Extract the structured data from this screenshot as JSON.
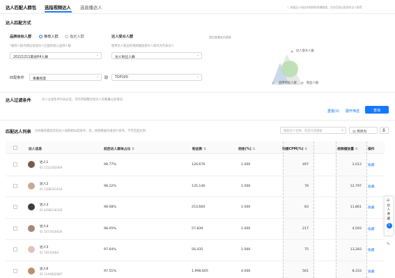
{
  "tabs": [
    {
      "label": "达人匹配人群包",
      "active": false
    },
    {
      "label": "选指视频达人",
      "active": true
    },
    {
      "label": "选直播达人",
      "active": false
    }
  ],
  "notice": "ⓘ 根据达人粉丝的视频和直播数据，优先匹配出契合的达人推荐",
  "section1": {
    "title": "达人匹配方式",
    "brand_label": "品牌目标人群",
    "radio_recommend": "推荐人群",
    "radio_custom": "指定人群",
    "brand_hint": "*推荐人群为建议投放达人匹配的核心品牌人群",
    "brand_select": "20221211美妆R4人群",
    "influencer_label": "达人受众人群",
    "influencer_hint": "使用达人粉丝的视频播放受众人群作为代表达人",
    "influencer_select": "达人粉丝人群",
    "diagram_title": "锁定重叠度的重要",
    "venn": {
      "top": "达人受众人群",
      "right": "粉丝人群",
      "bottom": "品牌目标人群"
    },
    "match_label": "匹配条件",
    "match_select": "重叠程度",
    "match_and": "取",
    "top_select": "TOP100"
  },
  "section2": {
    "title": "达人过滤条件",
    "hint": "达人过滤条件为非必选，可作用调整达到达人的数量过多情况",
    "reset": "重置(0)",
    "expand": "展开筛选",
    "query": "查询"
  },
  "list": {
    "title": "匹配达人列表",
    "hint": "为你推荐最契合的达人按照相似度排序，您，按照数据均值进行排序，不可匹配达到",
    "search_placeholder": "搜索达人名称、抖音号或搜索",
    "save_btn": "另存为",
    "columns": [
      "达人信息",
      "前后达人群体占比",
      "粉丝数",
      "佣金(%)",
      "均播CPM(%)",
      "视频播放量",
      "操作"
    ],
    "rows": [
      {
        "name": "达人1",
        "id": "ID 1152282069",
        "ratio": "98.77%",
        "fans": "126,676",
        "commission": "1.000",
        "cpm": "497",
        "plays": "2,012",
        "action": "收藏"
      },
      {
        "name": "达人2",
        "id": "ID 1288341634",
        "ratio": "98.22%",
        "fans": "135,146",
        "commission": "1.000",
        "cpm": "78",
        "plays": "12,797",
        "action": "收藏"
      },
      {
        "name": "达人3",
        "id": "ID 4298118326",
        "ratio": "98.08%",
        "fans": "253,660",
        "commission": "1.000",
        "cpm": "83",
        "plays": "11,861",
        "action": "收藏"
      },
      {
        "name": "达人4",
        "id": "ID 1073016626",
        "ratio": "98.05%",
        "fans": "57,839",
        "commission": "1.000",
        "cpm": "217",
        "plays": "4,593",
        "action": "收藏"
      },
      {
        "name": "达人5",
        "id": "ID 76535684",
        "ratio": "97.64%",
        "fans": "56,435",
        "commission": "1.000",
        "cpm": "75",
        "plays": "13,283",
        "action": "收藏"
      },
      {
        "name": "达人6",
        "id": "ID 1149802887",
        "ratio": "97.51%",
        "fans": "1,998,605",
        "commission": "4.000",
        "cpm": "561",
        "plays": "8,333",
        "action": "收藏"
      }
    ]
  },
  "side": {
    "label": "达人收藏",
    "count": "1"
  },
  "colors": {
    "accent": "#1677ff",
    "venn_blue": "#c7d7ea",
    "venn_green": "#b9dfb0"
  }
}
